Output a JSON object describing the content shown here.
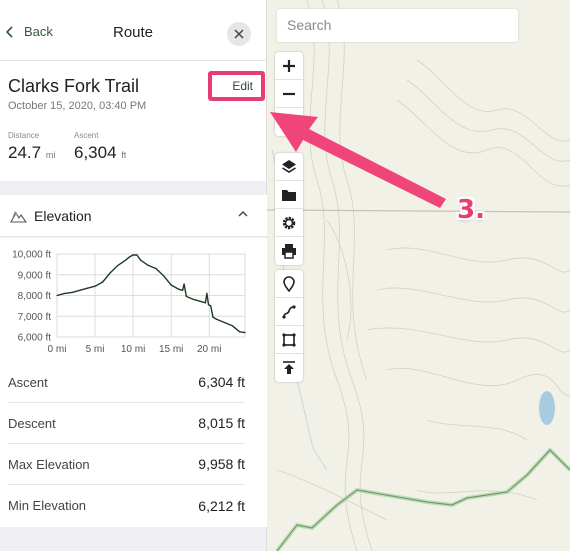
{
  "map": {
    "search": {
      "placeholder": "Search"
    },
    "tools_top": [
      {
        "icon": "zoom-in-icon",
        "glyph": "+"
      },
      {
        "icon": "zoom-out-icon",
        "glyph": "−"
      },
      {
        "icon": "locate-icon",
        "glyph": ""
      }
    ],
    "tools_mid": [
      {
        "icon": "layers-icon"
      },
      {
        "icon": "folder-icon"
      },
      {
        "icon": "settings-gear-icon"
      },
      {
        "icon": "print-icon"
      }
    ],
    "tools_draw": [
      {
        "icon": "waypoint-marker-icon"
      },
      {
        "icon": "route-draw-icon"
      },
      {
        "icon": "area-draw-icon"
      },
      {
        "icon": "upload-icon"
      }
    ]
  },
  "panel": {
    "header": {
      "back_label": "Back",
      "title": "Route",
      "close_icon": "close-icon"
    },
    "route": {
      "name": "Clarks Fork Trail",
      "date": "October 15, 2020, 03:40 PM",
      "edit_label": "Edit",
      "distance": {
        "label": "Distance",
        "value": "24.7",
        "unit": "mi"
      },
      "ascent": {
        "label": "Ascent",
        "value": "6,304",
        "unit": "ft"
      }
    },
    "elevation": {
      "title": "Elevation",
      "icon": "mountain-icon",
      "collapse_icon": "chevron-up-icon",
      "stats": [
        {
          "label": "Ascent",
          "value": "6,304 ft"
        },
        {
          "label": "Descent",
          "value": "8,015 ft"
        },
        {
          "label": "Max Elevation",
          "value": "9,958 ft"
        },
        {
          "label": "Min Elevation",
          "value": "6,212 ft"
        }
      ]
    }
  },
  "annotation": {
    "step_label": "3.",
    "color": "#e83d73"
  },
  "chart_data": {
    "type": "line",
    "title": "Elevation",
    "xlabel": "",
    "ylabel": "",
    "xlim": [
      0,
      24.7
    ],
    "ylim": [
      6000,
      10000
    ],
    "x_ticks": [
      0,
      5,
      10,
      15,
      20
    ],
    "x_tick_labels": [
      "0 mi",
      "5 mi",
      "10 mi",
      "15 mi",
      "20 mi"
    ],
    "y_ticks": [
      6000,
      7000,
      8000,
      9000,
      10000
    ],
    "y_tick_labels": [
      "6,000 ft",
      "7,000 ft",
      "8,000 ft",
      "9,000 ft",
      "10,000 ft"
    ],
    "grid": true,
    "series": [
      {
        "name": "Elevation",
        "color": "#1f3a22",
        "x": [
          0,
          1,
          2,
          3,
          4,
          5,
          6,
          7,
          8,
          9,
          9.5,
          10,
          10.5,
          11,
          12,
          13,
          14,
          15,
          16,
          16.5,
          16.7,
          17,
          18,
          19,
          19.5,
          19.7,
          19.9,
          20.2,
          20.5,
          21,
          22,
          23,
          24,
          24.7
        ],
        "y": [
          8000,
          8100,
          8150,
          8250,
          8350,
          8450,
          8650,
          9100,
          9450,
          9700,
          9850,
          9958,
          9950,
          9700,
          9450,
          9300,
          8950,
          8500,
          8300,
          8250,
          8550,
          7950,
          7800,
          7700,
          7650,
          8100,
          7550,
          7500,
          6950,
          6850,
          6700,
          6550,
          6250,
          6212
        ]
      }
    ]
  }
}
